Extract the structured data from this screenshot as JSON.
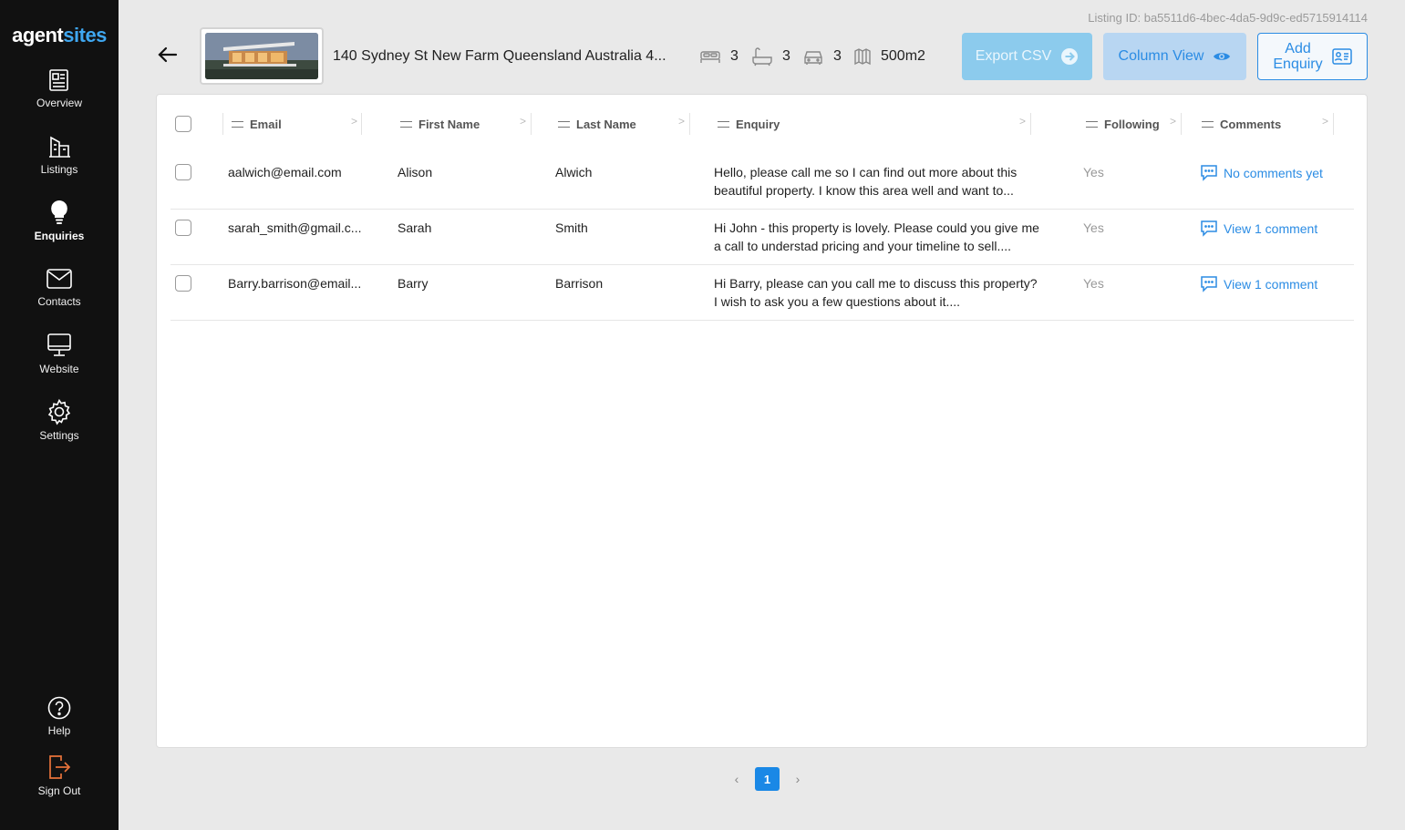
{
  "brand": {
    "part1": "agent",
    "part2": "sites"
  },
  "sidebar": {
    "items": [
      {
        "label": "Overview",
        "icon": "overview-icon"
      },
      {
        "label": "Listings",
        "icon": "listings-icon"
      },
      {
        "label": "Enquiries",
        "icon": "lightbulb-icon",
        "active": true
      },
      {
        "label": "Contacts",
        "icon": "mail-icon"
      },
      {
        "label": "Website",
        "icon": "monitor-icon"
      },
      {
        "label": "Settings",
        "icon": "gear-icon"
      }
    ],
    "bottom": [
      {
        "label": "Help",
        "icon": "help-icon"
      },
      {
        "label": "Sign Out",
        "icon": "sign-out-icon"
      }
    ]
  },
  "header": {
    "listing_id": "Listing ID: ba5511d6-4bec-4da5-9d9c-ed5715914114",
    "address": "140 Sydney St New Farm Queensland Australia 4...",
    "stats": {
      "beds": "3",
      "baths": "3",
      "cars": "3",
      "area": "500m2"
    },
    "export_label": "Export CSV",
    "column_view_label": "Column View",
    "add_enquiry_line1": "Add",
    "add_enquiry_line2": "Enquiry"
  },
  "table": {
    "columns": [
      "Email",
      "First Name",
      "Last Name",
      "Enquiry",
      "Following",
      "Comments"
    ],
    "rows": [
      {
        "email": "aalwich@email.com",
        "first": "Alison",
        "last": "Alwich",
        "enquiry": "Hello, please call me so I can find out more about this beautiful property. I know this area well and want to...",
        "following": "Yes",
        "comments": "No comments yet"
      },
      {
        "email": "sarah_smith@gmail.c...",
        "first": "Sarah",
        "last": "Smith",
        "enquiry": "Hi John - this property is lovely. Please could you give me a call to understad pricing and your timeline to sell....",
        "following": "Yes",
        "comments": "View 1 comment"
      },
      {
        "email": "Barry.barrison@email...",
        "first": "Barry",
        "last": "Barrison",
        "enquiry": "Hi Barry, please can you call me to discuss this property? I wish to ask you a few questions about it....",
        "following": "Yes",
        "comments": "View 1 comment"
      }
    ]
  },
  "pagination": {
    "current": "1",
    "prev": "‹",
    "next": "›"
  },
  "colors": {
    "sidebar_bg": "#111111",
    "accent": "#2b8ce4",
    "brand_blue": "#3fa7f0",
    "sign_out": "#e8733a"
  }
}
